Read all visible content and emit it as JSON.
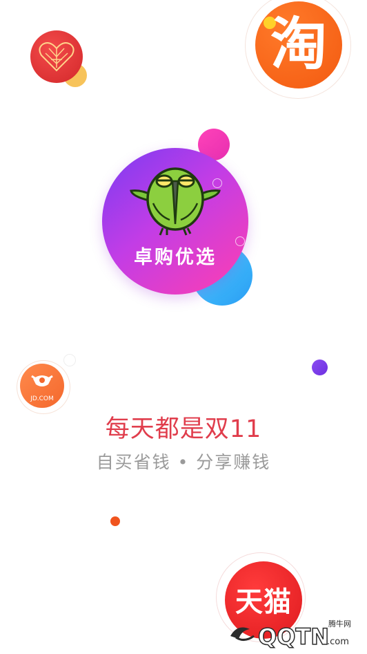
{
  "app": {
    "name": "卓购优选",
    "slogan": "每天都是双11",
    "tagline": "自买省钱 • 分享赚钱"
  },
  "badges": {
    "taobao": "淘",
    "jd": "JD.COM",
    "tmall": "天猫"
  },
  "watermark": {
    "brand": "QQTN",
    "suffix": ".com",
    "site": "腾牛网"
  },
  "colors": {
    "slogan": "#e03d4c",
    "tagline": "#9a9a9a",
    "brand_gradient_start": "#7a3cf2",
    "brand_gradient_end": "#ff3fb0"
  }
}
